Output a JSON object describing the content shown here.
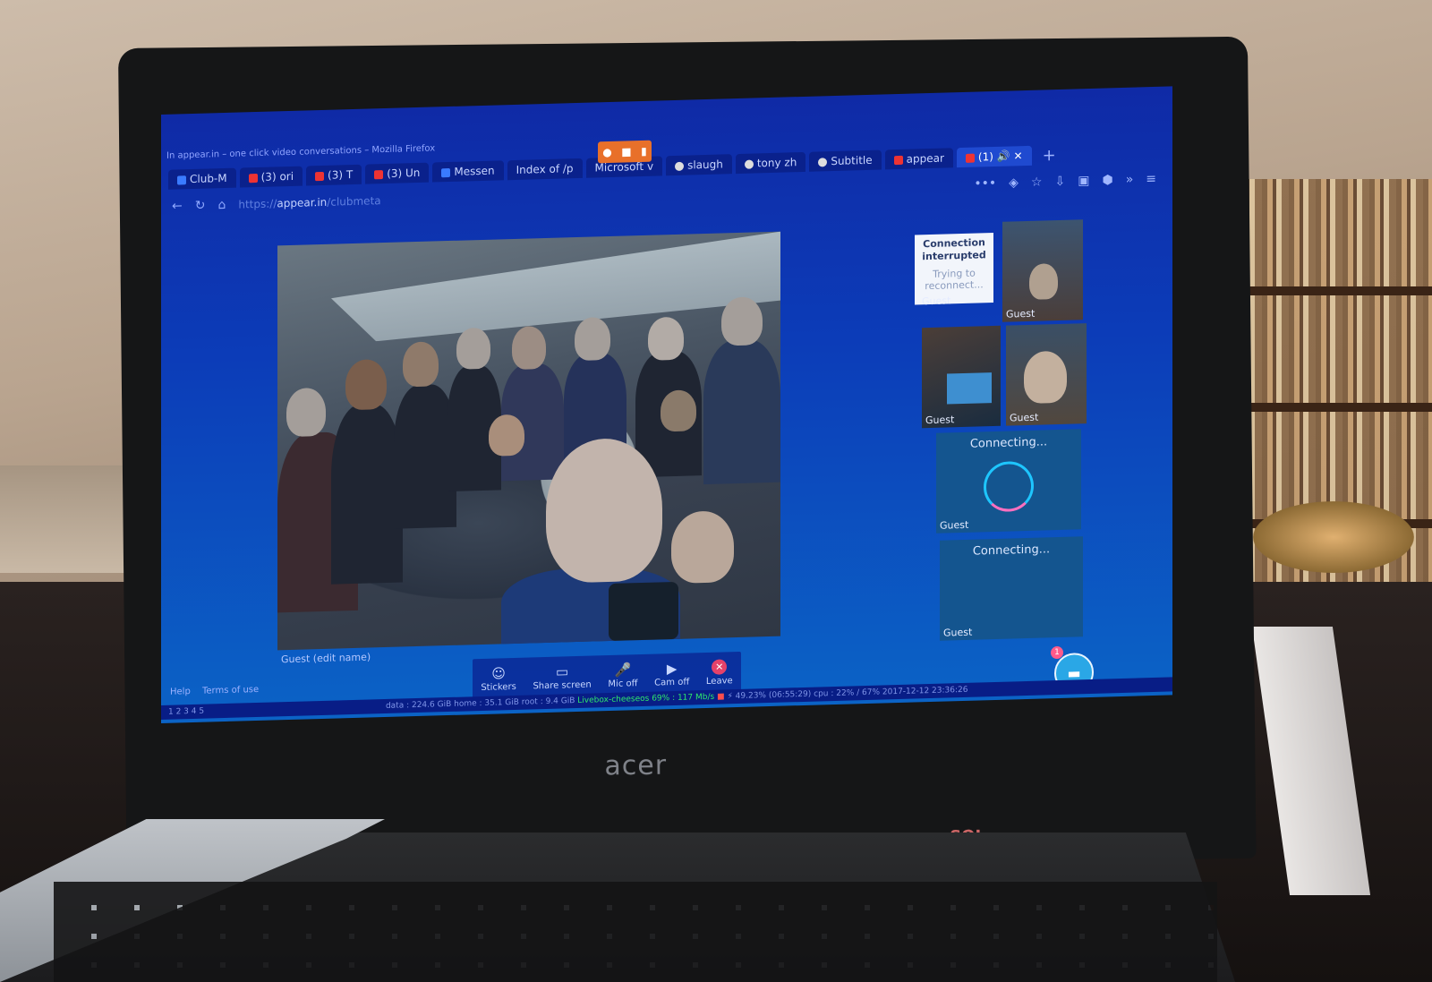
{
  "window": {
    "title": "In appear.in – one click video conversations – Mozilla Firefox"
  },
  "browser": {
    "tabs": [
      {
        "label": "Club-M",
        "icon": "document-icon"
      },
      {
        "label": "(3) ori",
        "icon": "youtube-icon"
      },
      {
        "label": "(3) T",
        "icon": "youtube-icon"
      },
      {
        "label": "(3) Un",
        "icon": "youtube-icon"
      },
      {
        "label": "Messen",
        "icon": "messenger-icon"
      },
      {
        "label": "Index of /p",
        "icon": ""
      },
      {
        "label": "Microsoft v",
        "icon": ""
      },
      {
        "label": "slaugh",
        "icon": "globe-icon"
      },
      {
        "label": "tony zh",
        "icon": "globe-icon"
      },
      {
        "label": "Subtitle",
        "icon": "subtitle-icon"
      },
      {
        "label": "appear",
        "icon": "appear-icon"
      },
      {
        "label": "(1)",
        "icon": "chat-icon"
      }
    ],
    "url_prefix": "https://",
    "url_domain": "appear.in",
    "url_path": "/clubmeta"
  },
  "video": {
    "main_label": "Guest (edit name)",
    "controls": [
      {
        "label": "Stickers",
        "icon": "sticker-icon"
      },
      {
        "label": "Share screen",
        "icon": "screen-share-icon"
      },
      {
        "label": "Mic off",
        "icon": "microphone-icon"
      },
      {
        "label": "Cam off",
        "icon": "camera-icon"
      },
      {
        "label": "Leave",
        "icon": "close-icon"
      }
    ]
  },
  "participants": {
    "interrupted_title": "Connection interrupted",
    "interrupted_sub": "Trying to reconnect...",
    "guest": "Guest",
    "connecting": "Connecting..."
  },
  "footer": {
    "help": "Help",
    "terms": "Terms of use"
  },
  "chat": {
    "unread": "1"
  },
  "taskbar": {
    "workspaces": "1 2 3 4 5",
    "status": "data : 224.6 GiB  home : 35.1 GiB  root : 9.4 GiB",
    "network": "Livebox-cheeseos  69% : 117 Mb/s",
    "battery": "⚡ 49.23% (06:55:29)  cpu : 22% / 67%",
    "datetime": "2017-12-12 23:36:26"
  },
  "device": {
    "brand": "acer",
    "sticker": "SOL"
  }
}
